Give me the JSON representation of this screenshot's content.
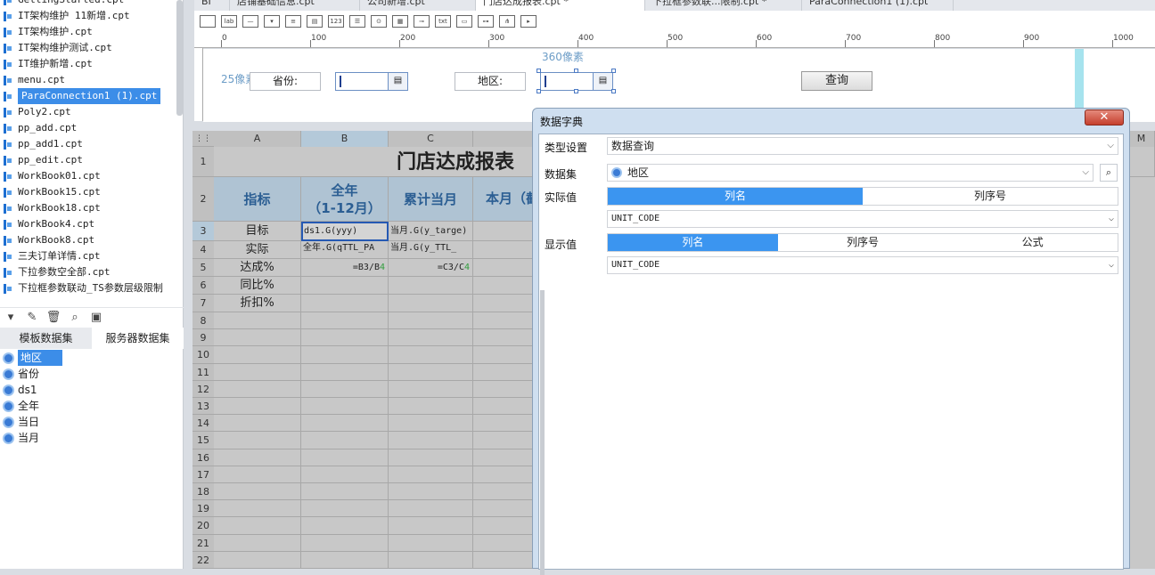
{
  "files": [
    "GettingStarted.cpt",
    "IT架构维护 11新增.cpt",
    "IT架构维护.cpt",
    "IT架构维护测试.cpt",
    "IT维护新增.cpt",
    "menu.cpt",
    "ParaConnection1 (1).cpt",
    "Poly2.cpt",
    "pp_add.cpt",
    "pp_add1.cpt",
    "pp_edit.cpt",
    "WorkBook01.cpt",
    "WorkBook15.cpt",
    "WorkBook18.cpt",
    "WorkBook4.cpt",
    "WorkBook8.cpt",
    "三夫订单详情.cpt",
    "下拉参数空全部.cpt",
    "下拉框参数联动_TS参数层级限制"
  ],
  "selected_file": "ParaConnection1 (1).cpt",
  "dataset_tabs": [
    "模板数据集",
    "服务器数据集"
  ],
  "datasets": [
    "地区",
    "省份",
    "ds1",
    "全年",
    "当日",
    "当月"
  ],
  "selected_dataset": "地区",
  "doc_tabs": [
    "BI",
    "店铺基础信息.cpt",
    "公司新增.cpt",
    "门店达成报表.cpt *",
    "下拉框参数联...限制.cpt *",
    "ParaConnection1 (1).cpt"
  ],
  "ruler_ticks": [
    "0",
    "100",
    "200",
    "300",
    "400",
    "500",
    "600",
    "700",
    "800",
    "900",
    "1000"
  ],
  "params": {
    "province_label": "省份:",
    "region_label": "地区:",
    "px_label_25": "25像素",
    "px_label_360": "360像素",
    "query_button": "查询"
  },
  "grid": {
    "columns": [
      "A",
      "B",
      "C",
      "M"
    ],
    "rows": [
      "1",
      "2",
      "3",
      "4",
      "5",
      "6",
      "7",
      "8",
      "9",
      "10",
      "11",
      "12",
      "13",
      "14",
      "15",
      "16",
      "17",
      "18",
      "19",
      "20",
      "21",
      "22"
    ],
    "title": "门店达成报表",
    "header": {
      "a": "指标",
      "b1": "全年",
      "b2": "（1-12月）",
      "c": "累计当月",
      "d": "本月（截"
    },
    "labels": [
      "目标",
      "实际",
      "达成%",
      "同比%",
      "折扣%"
    ],
    "b3": "ds1.G(yyy)",
    "c3": "当月.G(y_targe)",
    "b4": "全年.G(qTTL_PA",
    "c4": "当月.G(y_TTL_",
    "b5_main": "=B3/B",
    "b5_num": "4",
    "c5_main": "=C3/C",
    "c5_num": "4"
  },
  "dialog": {
    "title": "数据字典",
    "close": "✕",
    "type_label": "类型设置",
    "type_value": "数据查询",
    "dataset_label": "数据集",
    "dataset_value": "地区",
    "actual_label": "实际值",
    "actual_options": [
      "列名",
      "列序号"
    ],
    "actual_column": "UNIT_CODE",
    "display_label": "显示值",
    "display_options": [
      "列名",
      "列序号",
      "公式"
    ],
    "display_column": "UNIT_CODE"
  }
}
